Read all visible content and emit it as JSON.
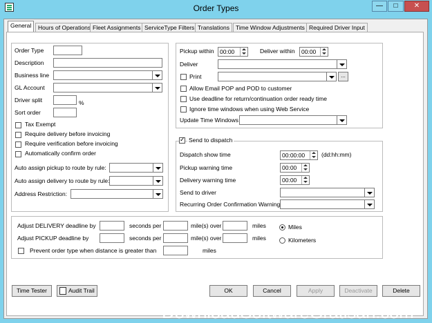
{
  "window": {
    "title": "Order Types",
    "minimize": "—",
    "maximize": "□",
    "close": "✕",
    "icon": "app-icon"
  },
  "tabs": [
    "General",
    "Hours of Operations",
    "Fleet Assignments",
    "ServiceType Filters",
    "Translations",
    "Time Window Adjustments",
    "Required Driver Input"
  ],
  "left": {
    "order_type": "Order Type",
    "description": "Description",
    "business_line": "Business line",
    "gl_account": "GL Account",
    "driver_split": "Driver split",
    "percent": "%",
    "sort_order": "Sort order",
    "tax_exempt": "Tax Exempt",
    "req_delivery": "Require delivery before invoicing",
    "req_verification": "Require verification before invoicing",
    "auto_confirm": "Automatically confirm order",
    "auto_pickup": "Auto assign pickup to route by rule:",
    "auto_delivery": "Auto assign delivery to route by rule:",
    "address_restriction": "Address Restriction:"
  },
  "right": {
    "pickup_within": "Pickup within",
    "pickup_value": "00:00",
    "deliver_within": "Deliver within",
    "deliver_value": "00:00",
    "deliver": "Deliver",
    "print": "Print",
    "ellipsis": "...",
    "allow_email": "Allow Email POP and POD to customer",
    "use_deadline": "Use deadline for return/continuation order ready time",
    "ignore_time": "Ignore time windows when using Web Service",
    "update_time_windows": "Update Time Windows"
  },
  "dispatch": {
    "send_to_dispatch": "Send to dispatch",
    "dispatch_show_time": "Dispatch show time",
    "dispatch_value": "00:00:00",
    "format_hint": "(dd:hh:mm)",
    "pickup_warning": "Pickup warning time",
    "pickup_warning_value": "00:00",
    "delivery_warning": "Delivery warning time",
    "delivery_warning_value": "00:00",
    "send_to_driver": "Send to driver",
    "recurring_warning": "Recurring Order Confirmation Warning"
  },
  "bottom": {
    "adjust_delivery": "Adjust DELIVERY deadline by",
    "adjust_pickup": "Adjust PICKUP deadline by",
    "seconds_per": "seconds per",
    "miles_over": "mile(s) over",
    "miles": "miles",
    "prevent": "Prevent order type when distance is greater than",
    "unit_miles": "Miles",
    "unit_km": "Kilometers"
  },
  "buttons": {
    "time_tester": "Time Tester",
    "audit_trail": "Audit Trail",
    "ok": "OK",
    "cancel": "Cancel",
    "apply": "Apply",
    "deactivate": "Deactivate",
    "delete": "Delete"
  },
  "watermark": "DownloadSoftwareGratisan.com"
}
